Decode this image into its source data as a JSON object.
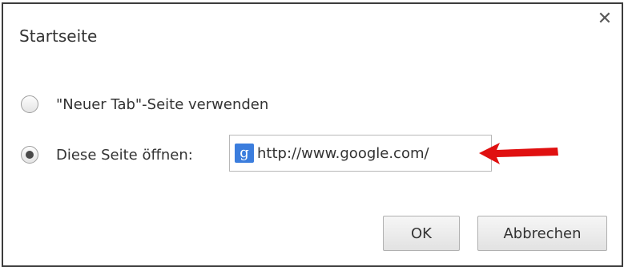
{
  "dialog": {
    "title": "Startseite",
    "close_icon": "close-icon"
  },
  "options": {
    "new_tab_label": "\"Neuer Tab\"-Seite verwenden",
    "new_tab_checked": false,
    "open_page_label": "Diese Seite öffnen:",
    "open_page_checked": true
  },
  "url_field": {
    "icon": "google-icon",
    "icon_glyph": "g",
    "value": "http://www.google.com/"
  },
  "annotation": {
    "icon": "red-arrow-icon",
    "color": "#e01010"
  },
  "buttons": {
    "ok_label": "OK",
    "cancel_label": "Abbrechen"
  }
}
